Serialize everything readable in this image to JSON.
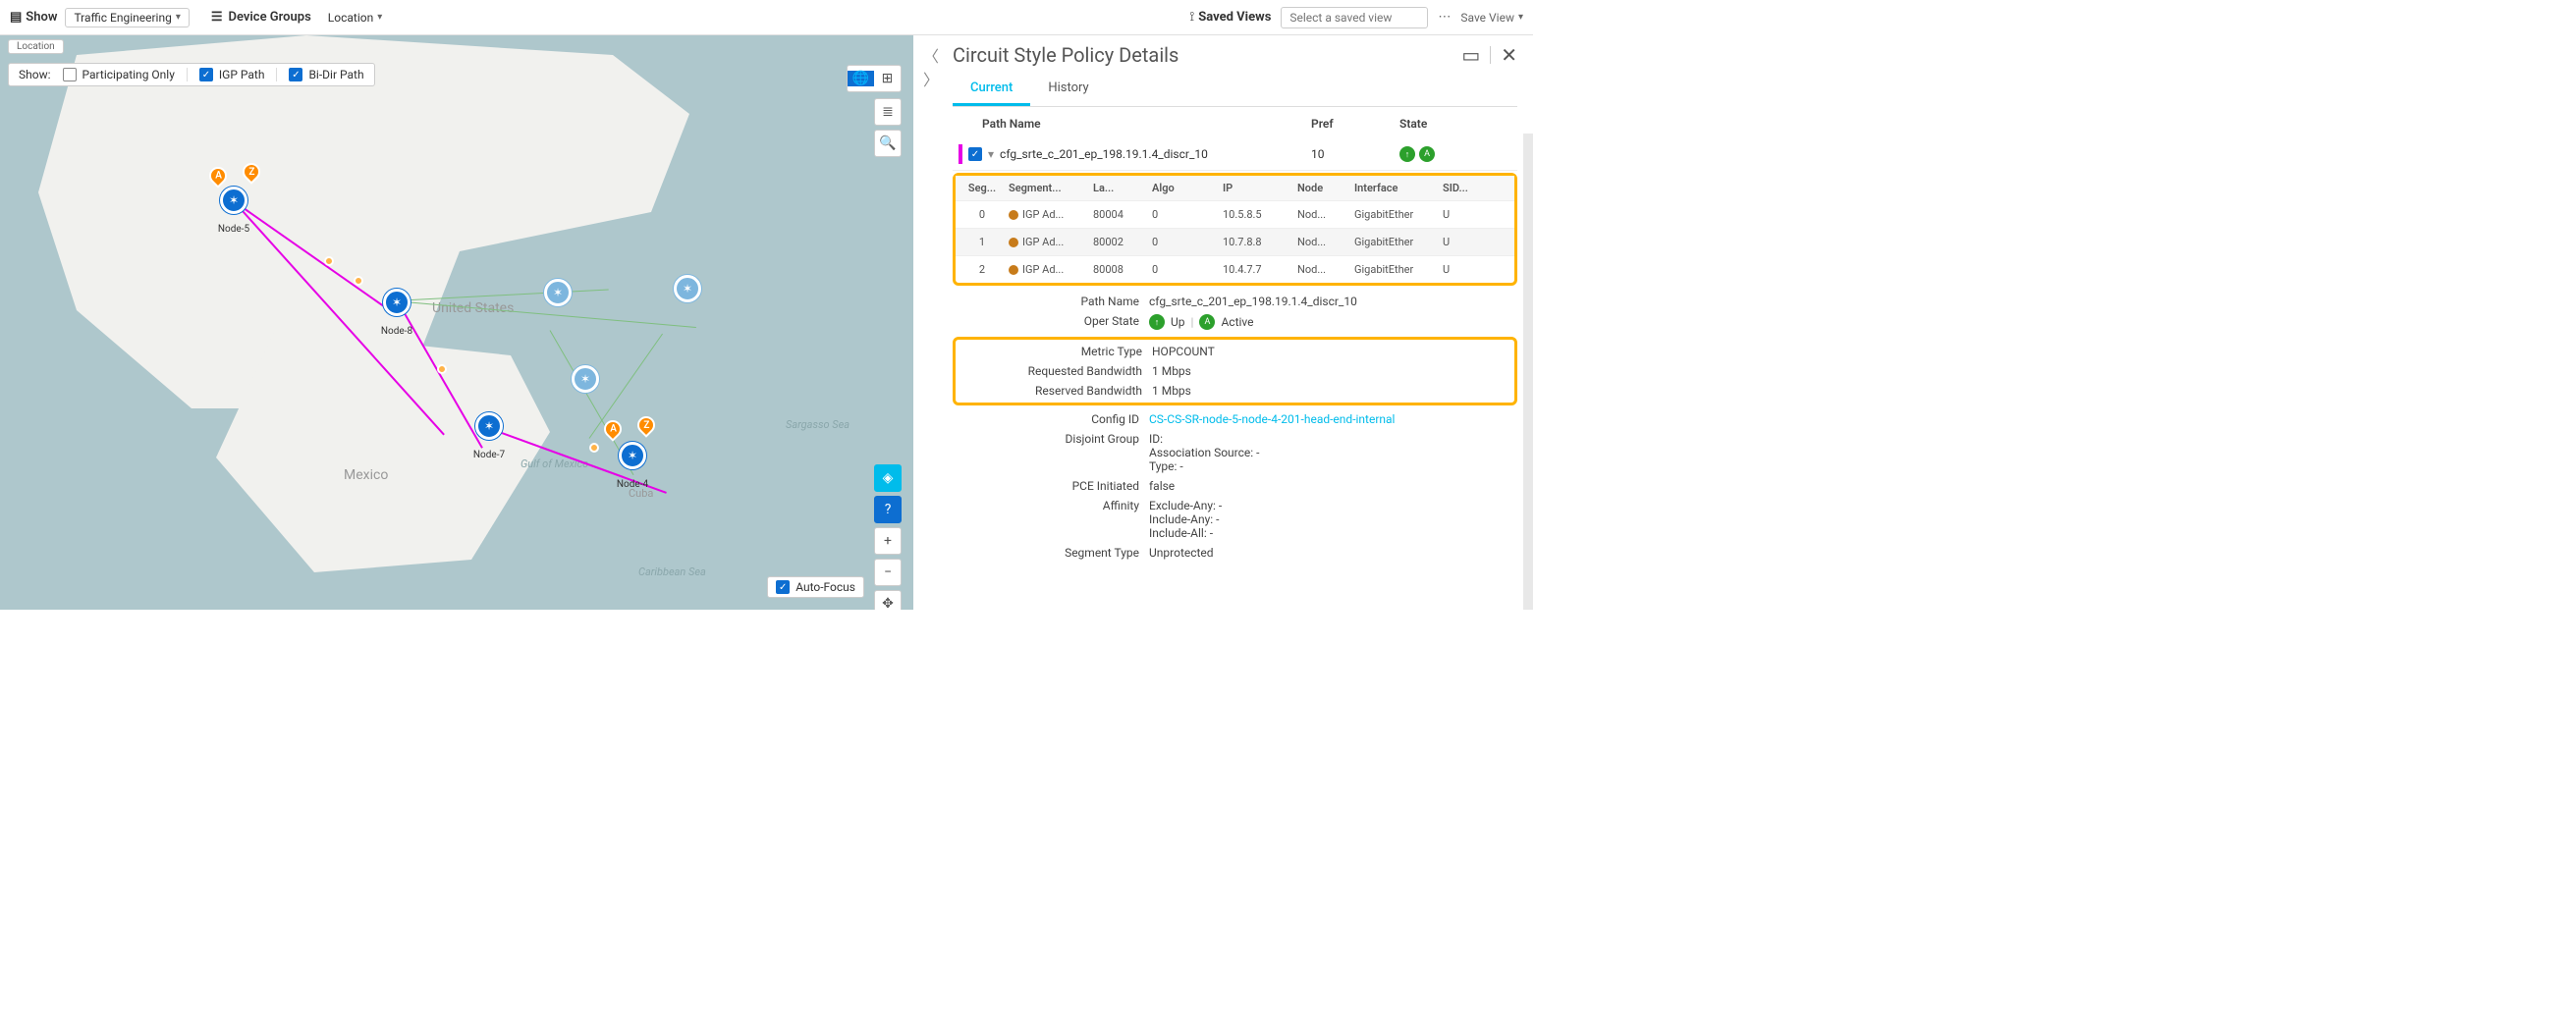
{
  "topbar": {
    "show_label": "Show",
    "show_value": "Traffic Engineering",
    "device_groups_label": "Device Groups",
    "location_label": "Location",
    "saved_views_label": "Saved Views",
    "saved_placeholder": "Select a saved view",
    "save_view_label": "Save View"
  },
  "breadcrumb": "Location",
  "filter": {
    "show_label": "Show:",
    "participating_label": "Participating Only",
    "igp_label": "IGP Path",
    "bidir_label": "Bi-Dir Path"
  },
  "map": {
    "us_label": "United States",
    "mexico_label": "Mexico",
    "gulf_label": "Gulf of Mexico",
    "carib_label": "Caribbean Sea",
    "sargasso_label": "Sargasso Sea",
    "cuba_label": "Cuba",
    "nodes": {
      "n5": "Node-5",
      "n8": "Node-8",
      "n7": "Node-7",
      "n4": "Node-4"
    },
    "auto_focus": "Auto-Focus"
  },
  "panel": {
    "title": "Circuit Style Policy Details",
    "tabs": {
      "current": "Current",
      "history": "History"
    },
    "path_header": {
      "name": "Path Name",
      "pref": "Pref",
      "state": "State"
    },
    "path_row": {
      "name": "cfg_srte_c_201_ep_198.19.1.4_discr_10",
      "pref": "10"
    },
    "seg_header": [
      "Seg...",
      "Segment...",
      "La...",
      "Algo",
      "IP",
      "Node",
      "Interface",
      "SID..."
    ],
    "segments": [
      {
        "idx": "0",
        "type": "IGP Ad...",
        "label": "80004",
        "algo": "0",
        "ip": "10.5.8.5",
        "node": "Nod...",
        "intf": "GigabitEther",
        "sid": "U"
      },
      {
        "idx": "1",
        "type": "IGP Ad...",
        "label": "80002",
        "algo": "0",
        "ip": "10.7.8.8",
        "node": "Nod...",
        "intf": "GigabitEther",
        "sid": "U"
      },
      {
        "idx": "2",
        "type": "IGP Ad...",
        "label": "80008",
        "algo": "0",
        "ip": "10.4.7.7",
        "node": "Nod...",
        "intf": "GigabitEther",
        "sid": "U"
      }
    ],
    "kv": {
      "path_name_k": "Path Name",
      "path_name_v": "cfg_srte_c_201_ep_198.19.1.4_discr_10",
      "oper_state_k": "Oper State",
      "oper_up": "Up",
      "oper_active": "Active",
      "metric_k": "Metric Type",
      "metric_v": "HOPCOUNT",
      "req_bw_k": "Requested Bandwidth",
      "req_bw_v": "1 Mbps",
      "res_bw_k": "Reserved Bandwidth",
      "res_bw_v": "1 Mbps",
      "config_k": "Config ID",
      "config_v": "CS-CS-SR-node-5-node-4-201-head-end-internal",
      "disjoint_k": "Disjoint Group",
      "disjoint_v1": "ID:",
      "disjoint_v2": "Association Source: -",
      "disjoint_v3": "Type: -",
      "pce_k": "PCE Initiated",
      "pce_v": "false",
      "affinity_k": "Affinity",
      "affinity_v1": "Exclude-Any: -",
      "affinity_v2": "Include-Any: -",
      "affinity_v3": "Include-All: -",
      "seg_type_k": "Segment Type",
      "seg_type_v": "Unprotected"
    }
  }
}
